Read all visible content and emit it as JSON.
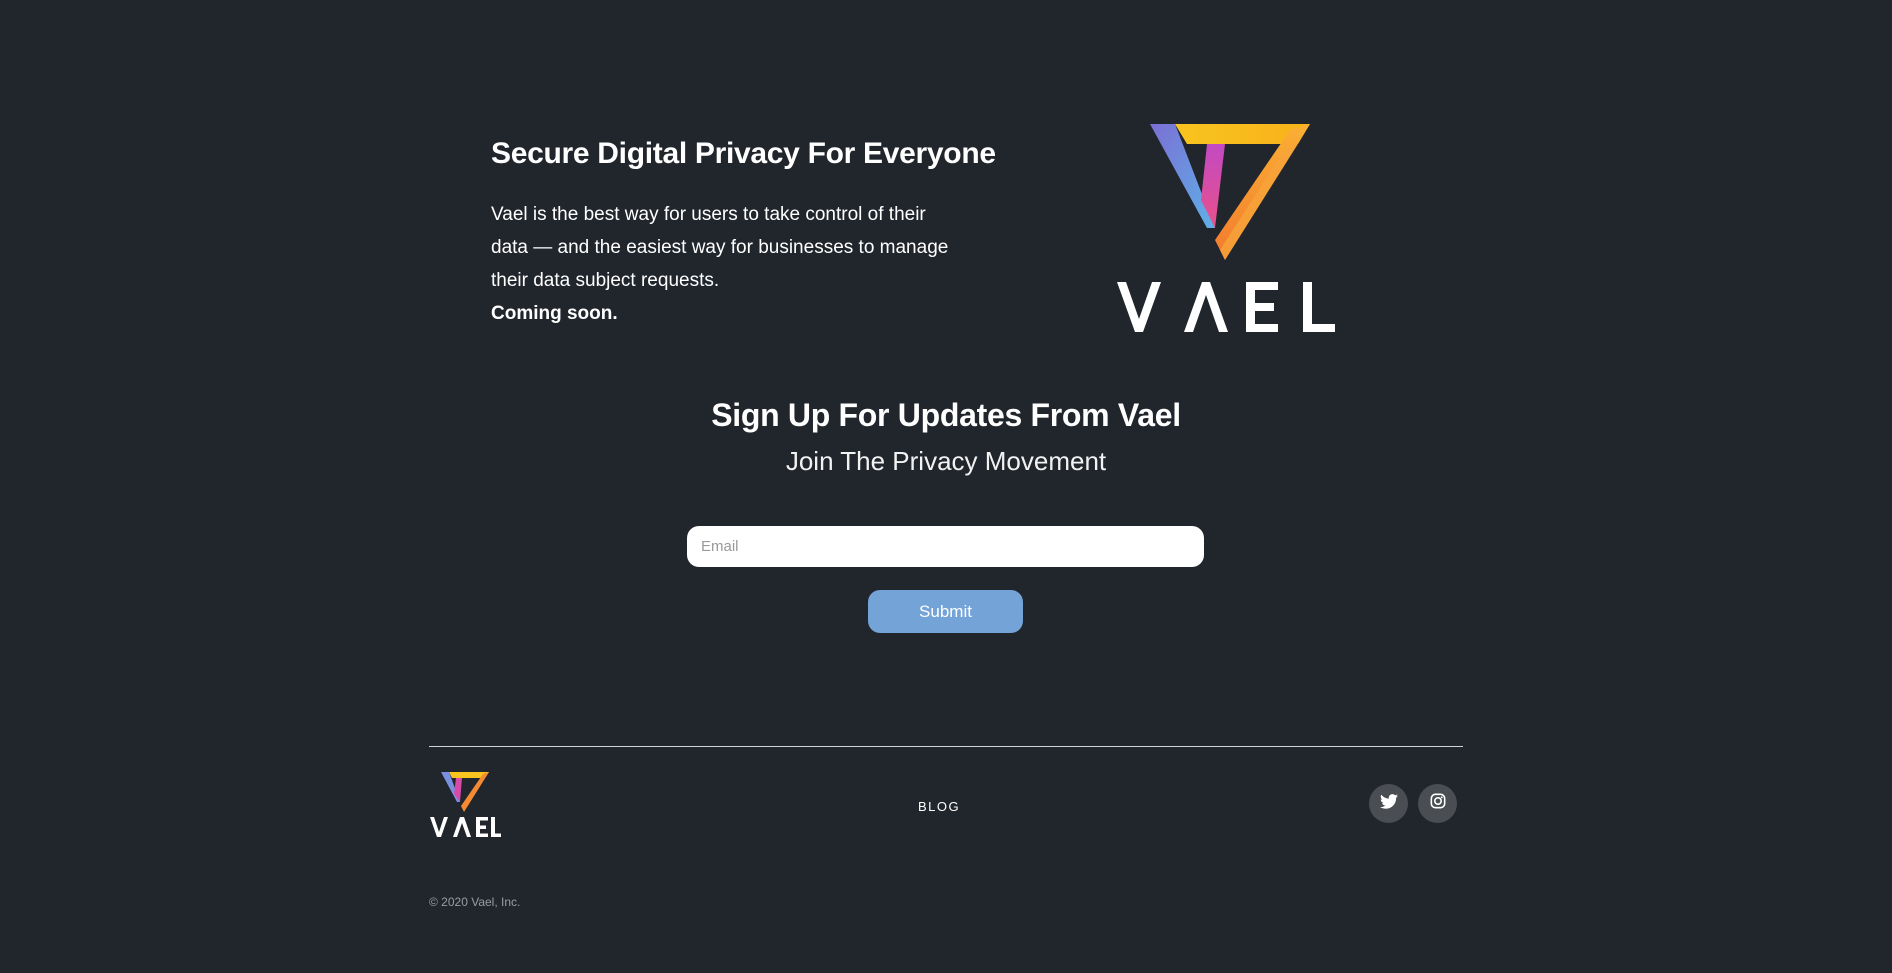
{
  "hero": {
    "title": "Secure Digital Privacy For Everyone",
    "description": "Vael is the best way for users to take control of their data — and the easiest way for businesses to manage their data subject requests.",
    "coming_soon": "Coming soon.",
    "logo_wordmark": "VAEL"
  },
  "signup": {
    "title": "Sign Up For Updates From Vael",
    "subtitle": "Join The Privacy Movement",
    "email_placeholder": "Email",
    "email_value": "",
    "submit_label": "Submit"
  },
  "footer": {
    "logo_wordmark": "VAEL",
    "nav": [
      {
        "label": "BLOG"
      }
    ],
    "social": [
      {
        "icon": "twitter-icon"
      },
      {
        "icon": "instagram-icon"
      }
    ],
    "copyright": "© 2020 Vael, Inc."
  },
  "colors": {
    "background": "#21252c",
    "submit_button": "#74a3d8",
    "social_circle": "#4a4d52",
    "logo_yellow": "#f9c41f",
    "logo_orange": "#f58a32",
    "logo_blue": "#6aa7e0",
    "logo_magenta": "#d64aa8"
  }
}
